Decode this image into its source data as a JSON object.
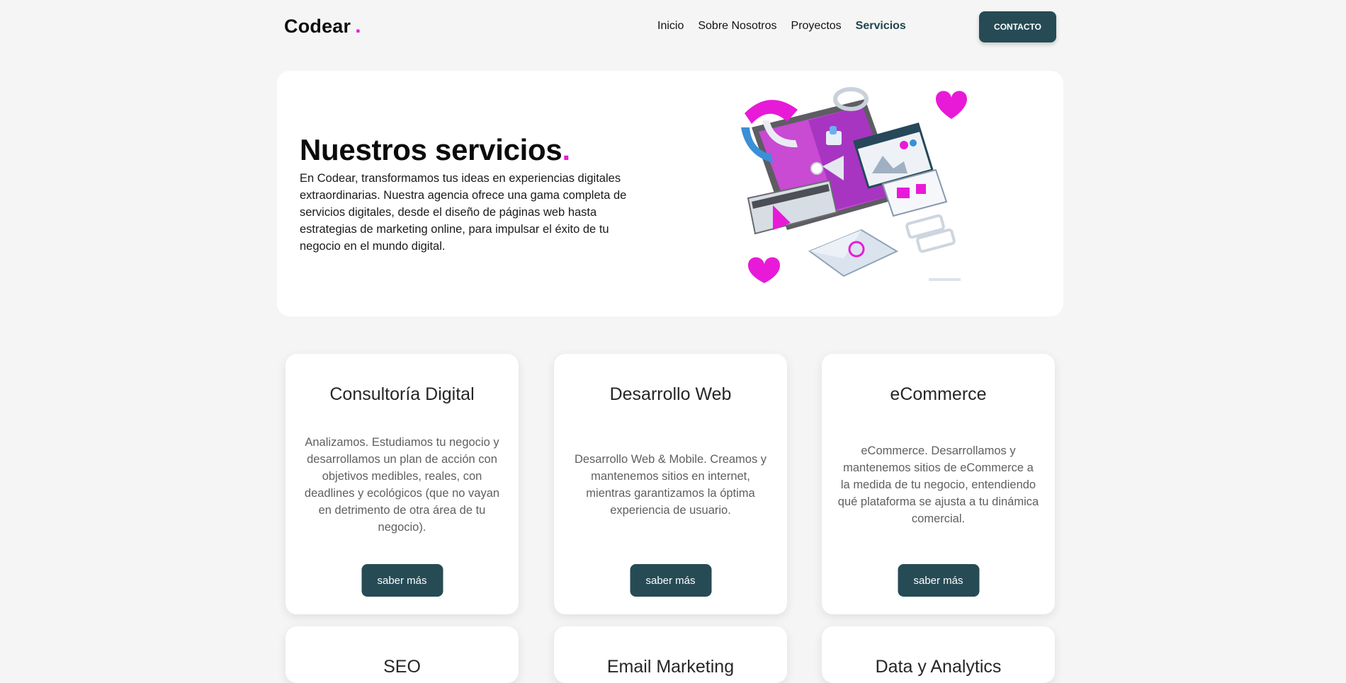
{
  "header": {
    "logo": "Codear",
    "logo_dot": ".",
    "nav": [
      "Inicio",
      "Sobre Nosotros",
      "Proyectos",
      "Servicios"
    ],
    "active_nav": "Servicios",
    "contact_label": "CONTACTO"
  },
  "hero": {
    "title": "Nuestros servicios",
    "title_dot": ".",
    "description": "En Codear, transformamos tus ideas en experiencias digitales extraordinarias. Nuestra agencia ofrece una gama completa de servicios digitales, desde el diseño de páginas web hasta estrategias de marketing online, para impulsar el éxito de tu negocio en el mundo digital."
  },
  "services": [
    {
      "title": "Consultoría Digital",
      "description": "Analizamos. Estudiamos tu negocio y desarrollamos un plan de acción con objetivos medibles, reales, con deadlines y ecológicos (que no vayan en detrimento de otra área de tu negocio).",
      "button": "saber más"
    },
    {
      "title": "Desarrollo Web",
      "description": "Desarrollo Web & Mobile. Creamos y mantenemos sitios en internet, mientras garantizamos la óptima experiencia de usuario.",
      "button": "saber más"
    },
    {
      "title": "eCommerce",
      "description": "eCommerce. Desarrollamos y mantenemos sitios de eCommerce a la medida de tu negocio, entendiendo qué plataforma se ajusta a tu dinámica comercial.",
      "button": "saber más"
    },
    {
      "title": "SEO"
    },
    {
      "title": "Email Marketing"
    },
    {
      "title": "Data y Analytics"
    }
  ],
  "colors": {
    "accent": "#e81ad8",
    "primary": "#264b55",
    "background": "#f5f5f5"
  }
}
